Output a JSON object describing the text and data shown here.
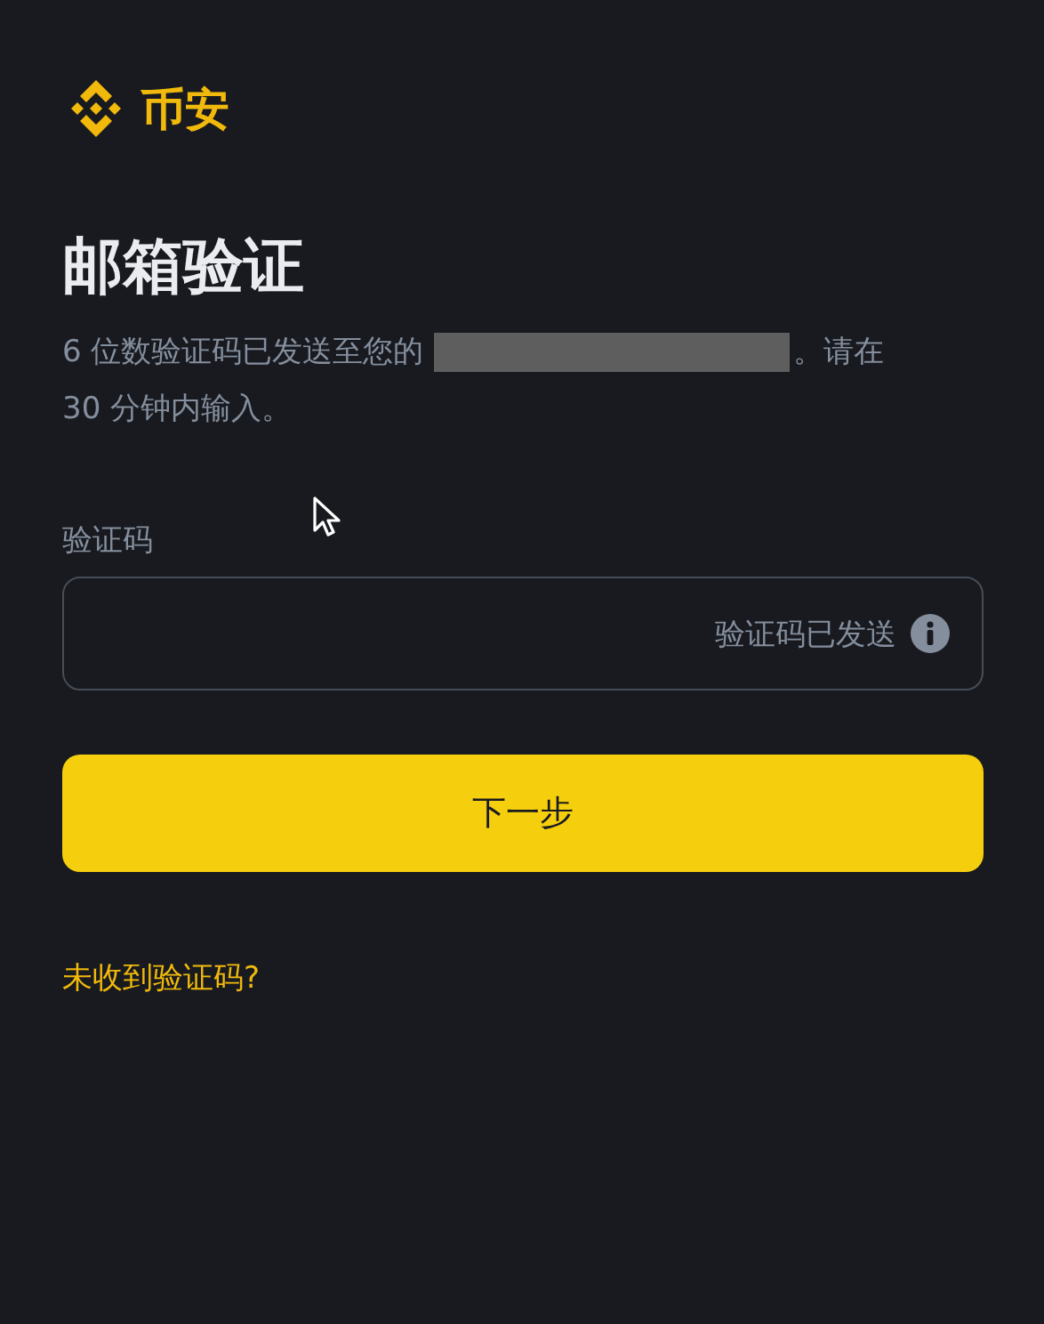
{
  "brand": {
    "name": "币安"
  },
  "title": "邮箱验证",
  "description": {
    "before": "6 位数验证码已发送至您的",
    "after": "。请在",
    "line_2": "30 分钟内输入。",
    "redacted": true
  },
  "code_field": {
    "label": "验证码",
    "status": "验证码已发送"
  },
  "next_button": {
    "label": "下一步"
  },
  "help_link": "未收到验证码?",
  "cursor": {
    "visible": true
  }
}
